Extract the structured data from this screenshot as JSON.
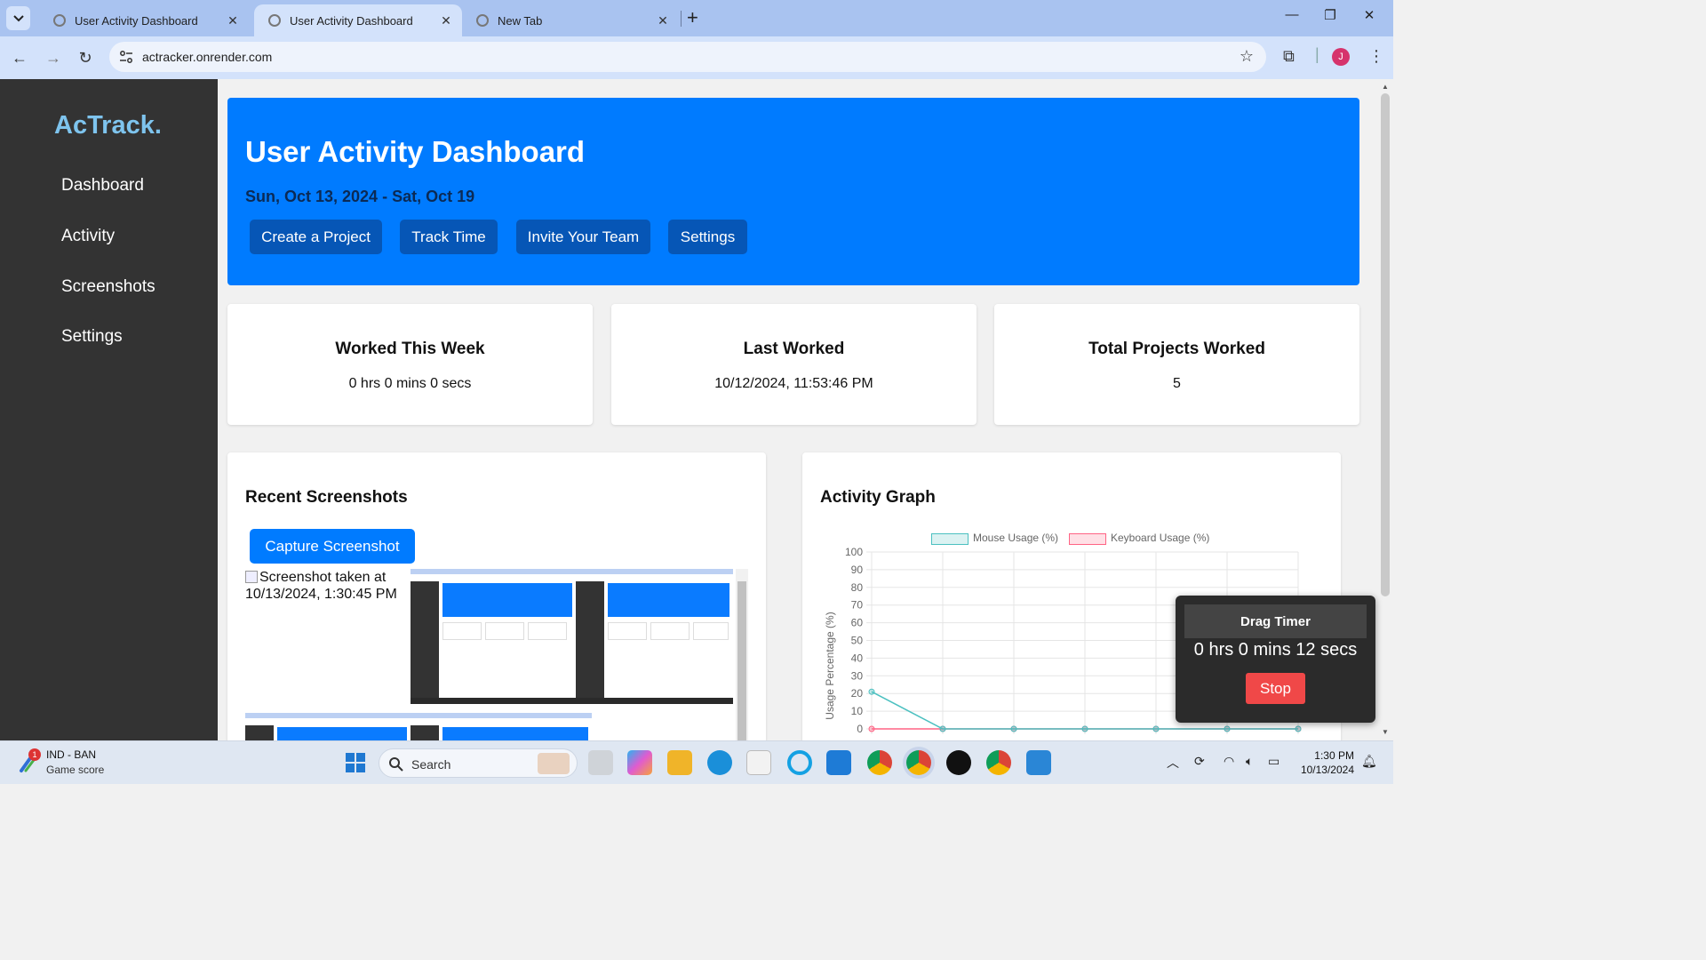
{
  "browser": {
    "tabs": [
      {
        "title": "User Activity Dashboard",
        "active": false
      },
      {
        "title": "User Activity Dashboard",
        "active": true
      },
      {
        "title": "New Tab",
        "active": false
      }
    ],
    "url": "actracker.onrender.com",
    "profile_initial": "J"
  },
  "sidebar": {
    "brand": "AcTrack.",
    "items": [
      {
        "label": "Dashboard"
      },
      {
        "label": "Activity"
      },
      {
        "label": "Screenshots"
      },
      {
        "label": "Settings"
      }
    ]
  },
  "hero": {
    "title": "User Activity Dashboard",
    "date_range": "Sun, Oct 13, 2024 - Sat, Oct 19",
    "buttons": [
      {
        "label": "Create a Project"
      },
      {
        "label": "Track Time"
      },
      {
        "label": "Invite Your Team"
      },
      {
        "label": "Settings"
      }
    ]
  },
  "stats": [
    {
      "title": "Worked This Week",
      "value": "0 hrs 0 mins 0 secs"
    },
    {
      "title": "Last Worked",
      "value": "10/12/2024, 11:53:46 PM"
    },
    {
      "title": "Total Projects Worked",
      "value": "5"
    }
  ],
  "screenshots": {
    "title": "Recent Screenshots",
    "capture_label": "Capture Screenshot",
    "alt_text": "Screenshot taken at 10/13/2024, 1:30:45 PM"
  },
  "activity_graph": {
    "title": "Activity Graph"
  },
  "chart_data": {
    "type": "line",
    "title": "",
    "xlabel": "",
    "ylabel": "Usage Percentage (%)",
    "ylim": [
      0,
      100
    ],
    "yticks": [
      0,
      10,
      20,
      30,
      40,
      50,
      60,
      70,
      80,
      90,
      100
    ],
    "x": [
      0,
      1,
      2,
      3,
      4,
      5,
      6
    ],
    "series": [
      {
        "name": "Mouse Usage (%)",
        "color": "#4bc0c0",
        "values": [
          21,
          0,
          0,
          0,
          0,
          0,
          0
        ]
      },
      {
        "name": "Keyboard Usage (%)",
        "color": "#ff6384",
        "values": [
          0,
          0,
          0,
          0,
          0,
          0,
          0
        ]
      }
    ],
    "grid": true,
    "legend": "top"
  },
  "timer": {
    "title": "Drag Timer",
    "value": "0 hrs 0 mins 12 secs",
    "stop_label": "Stop"
  },
  "taskbar": {
    "weather_line1": "IND - BAN",
    "weather_line2": "Game score",
    "notification_count": "1",
    "search_label": "Search",
    "time": "1:30 PM",
    "date": "10/13/2024"
  },
  "colors": {
    "accent": "#007bff",
    "hero_button": "#0656b6",
    "sidebar": "#333333",
    "brand": "#7ec4ee",
    "stop": "#f04848"
  }
}
